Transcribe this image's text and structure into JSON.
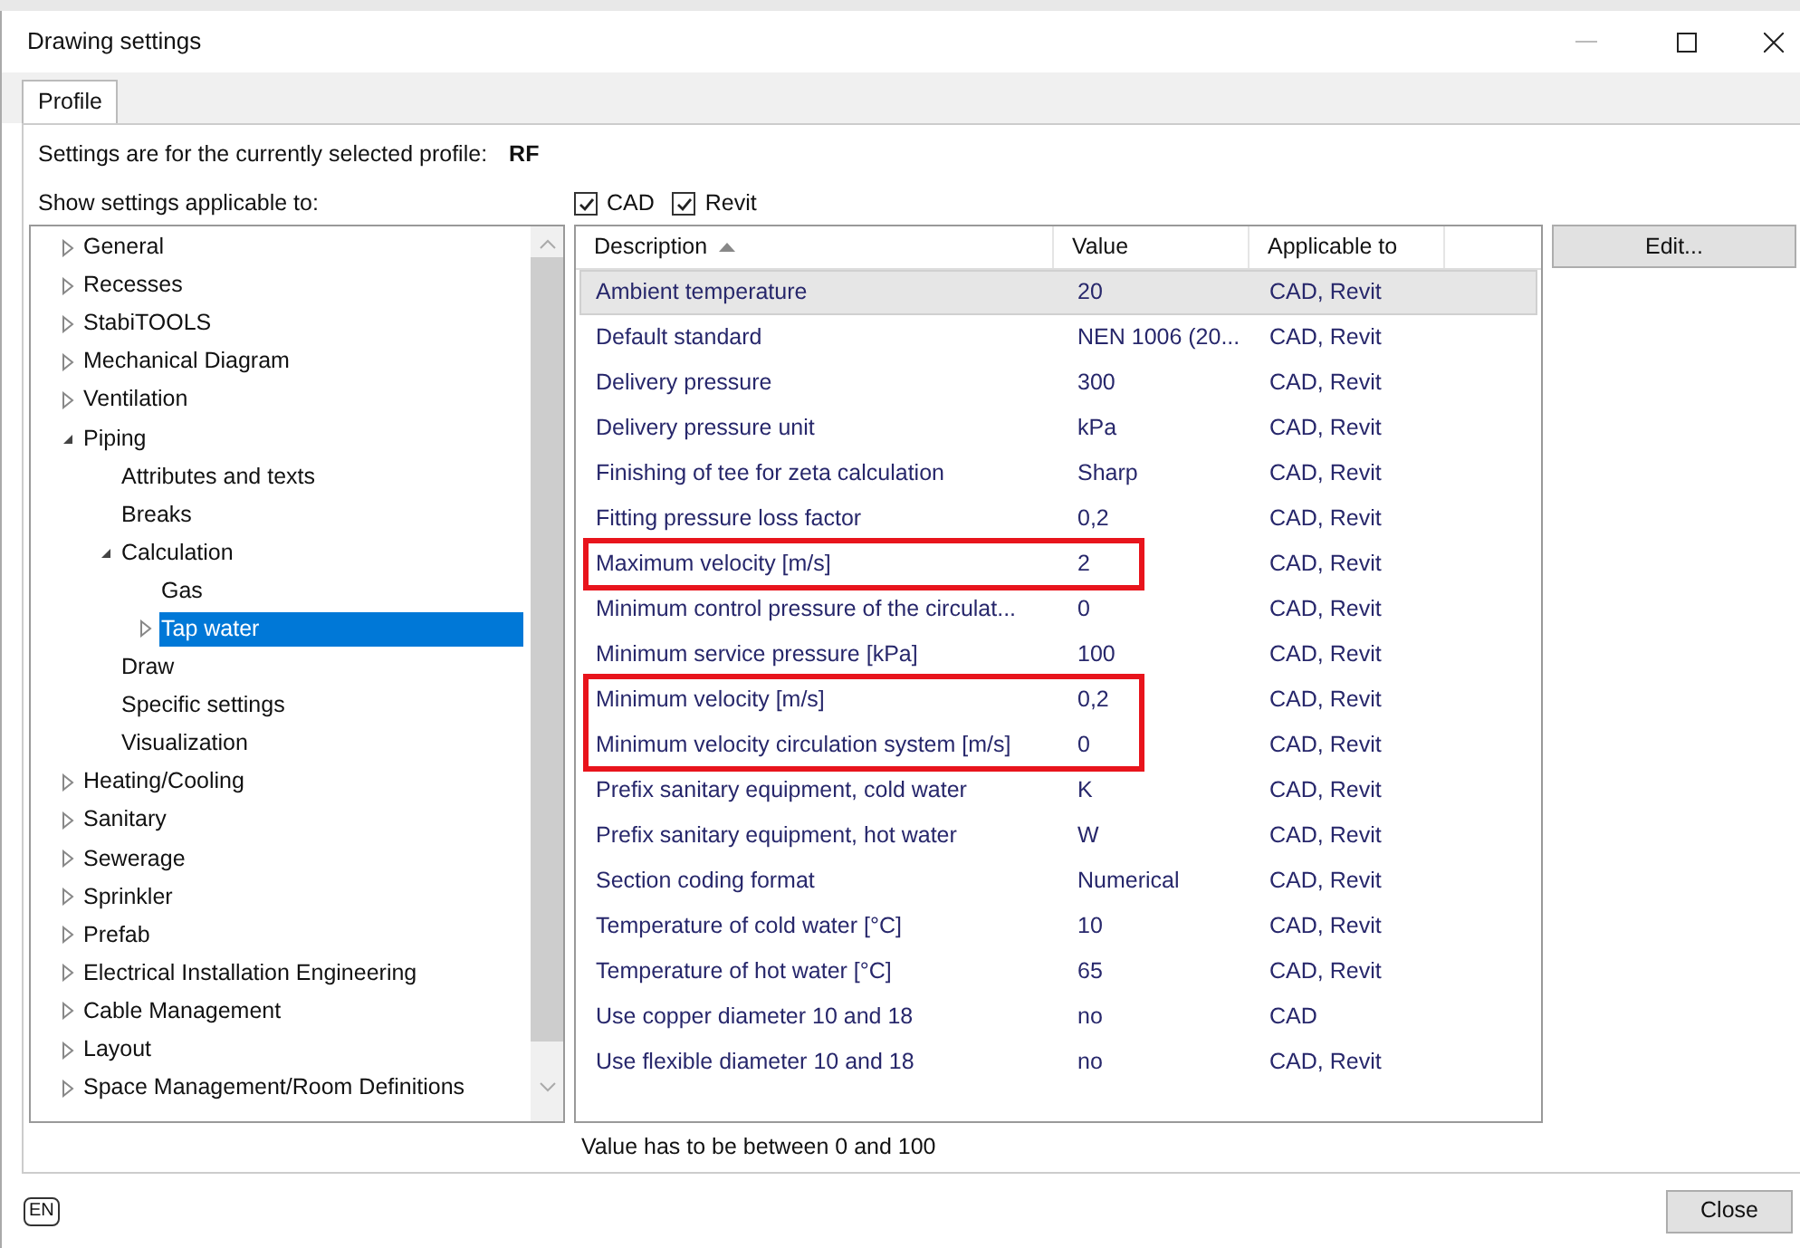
{
  "window": {
    "title": "Drawing settings"
  },
  "tabs": [
    {
      "label": "Profile",
      "selected": true
    }
  ],
  "profile_line": {
    "label": "Settings are for the currently selected profile:",
    "value": "RF"
  },
  "filter": {
    "label": "Show settings applicable to:",
    "options": [
      {
        "label": "CAD",
        "checked": true
      },
      {
        "label": "Revit",
        "checked": true
      }
    ]
  },
  "tree": [
    {
      "label": "General",
      "kind": "folder",
      "expanded": false,
      "selected": false
    },
    {
      "label": "Recesses",
      "kind": "folder",
      "expanded": false,
      "selected": false
    },
    {
      "label": "StabiTOOLS",
      "kind": "folder",
      "expanded": false,
      "selected": false
    },
    {
      "label": "Mechanical Diagram",
      "kind": "folder",
      "expanded": false,
      "selected": false
    },
    {
      "label": "Ventilation",
      "kind": "folder",
      "expanded": false,
      "selected": false
    },
    {
      "label": "Piping",
      "kind": "folder",
      "expanded": true,
      "selected": false,
      "children": [
        {
          "label": "Attributes and texts",
          "kind": "leaf",
          "selected": false
        },
        {
          "label": "Breaks",
          "kind": "leaf",
          "selected": false
        },
        {
          "label": "Calculation",
          "kind": "folder",
          "expanded": true,
          "selected": false,
          "children": [
            {
              "label": "Gas",
              "kind": "leaf",
              "selected": false
            },
            {
              "label": "Tap water",
              "kind": "folder",
              "expanded": false,
              "selected": true
            }
          ]
        },
        {
          "label": "Draw",
          "kind": "leaf",
          "selected": false
        },
        {
          "label": "Specific settings",
          "kind": "leaf",
          "selected": false
        },
        {
          "label": "Visualization",
          "kind": "leaf",
          "selected": false
        }
      ]
    },
    {
      "label": "Heating/Cooling",
      "kind": "folder",
      "expanded": false,
      "selected": false
    },
    {
      "label": "Sanitary",
      "kind": "folder",
      "expanded": false,
      "selected": false
    },
    {
      "label": "Sewerage",
      "kind": "folder",
      "expanded": false,
      "selected": false
    },
    {
      "label": "Sprinkler",
      "kind": "folder",
      "expanded": false,
      "selected": false
    },
    {
      "label": "Prefab",
      "kind": "folder",
      "expanded": false,
      "selected": false
    },
    {
      "label": "Electrical Installation Engineering",
      "kind": "folder",
      "expanded": false,
      "selected": false
    },
    {
      "label": "Cable Management",
      "kind": "folder",
      "expanded": false,
      "selected": false
    },
    {
      "label": "Layout",
      "kind": "folder",
      "expanded": false,
      "selected": false
    },
    {
      "label": "Space Management/Room Definitions",
      "kind": "folder",
      "expanded": false,
      "selected": false
    }
  ],
  "table": {
    "columns": [
      {
        "label": "Description",
        "sorted": true
      },
      {
        "label": "Value",
        "sorted": false
      },
      {
        "label": "Applicable to",
        "sorted": false
      }
    ],
    "rows": [
      {
        "description": "Ambient temperature",
        "value": "20",
        "applicable_to": "CAD, Revit",
        "selected": true,
        "highlighted": false
      },
      {
        "description": "Default standard",
        "value": "NEN 1006 (20...",
        "applicable_to": "CAD, Revit",
        "selected": false,
        "highlighted": false
      },
      {
        "description": "Delivery pressure",
        "value": "300",
        "applicable_to": "CAD, Revit",
        "selected": false,
        "highlighted": false
      },
      {
        "description": "Delivery pressure unit",
        "value": "kPa",
        "applicable_to": "CAD, Revit",
        "selected": false,
        "highlighted": false
      },
      {
        "description": "Finishing of tee for zeta calculation",
        "value": "Sharp",
        "applicable_to": "CAD, Revit",
        "selected": false,
        "highlighted": false
      },
      {
        "description": "Fitting pressure loss factor",
        "value": "0,2",
        "applicable_to": "CAD, Revit",
        "selected": false,
        "highlighted": false
      },
      {
        "description": "Maximum velocity [m/s]",
        "value": "2",
        "applicable_to": "CAD, Revit",
        "selected": false,
        "highlighted": true
      },
      {
        "description": "Minimum control pressure of the circulat...",
        "value": "0",
        "applicable_to": "CAD, Revit",
        "selected": false,
        "highlighted": false
      },
      {
        "description": "Minimum service pressure [kPa]",
        "value": "100",
        "applicable_to": "CAD, Revit",
        "selected": false,
        "highlighted": false
      },
      {
        "description": "Minimum velocity [m/s]",
        "value": "0,2",
        "applicable_to": "CAD, Revit",
        "selected": false,
        "highlighted": true
      },
      {
        "description": "Minimum velocity circulation system [m/s]",
        "value": "0",
        "applicable_to": "CAD, Revit",
        "selected": false,
        "highlighted": true
      },
      {
        "description": "Prefix sanitary equipment, cold water",
        "value": "K",
        "applicable_to": "CAD, Revit",
        "selected": false,
        "highlighted": false
      },
      {
        "description": "Prefix sanitary equipment, hot water",
        "value": "W",
        "applicable_to": "CAD, Revit",
        "selected": false,
        "highlighted": false
      },
      {
        "description": "Section coding format",
        "value": "Numerical",
        "applicable_to": "CAD, Revit",
        "selected": false,
        "highlighted": false
      },
      {
        "description": "Temperature of cold water [°C]",
        "value": "10",
        "applicable_to": "CAD, Revit",
        "selected": false,
        "highlighted": false
      },
      {
        "description": "Temperature of hot water [°C]",
        "value": "65",
        "applicable_to": "CAD, Revit",
        "selected": false,
        "highlighted": false
      },
      {
        "description": "Use copper diameter 10 and 18",
        "value": "no",
        "applicable_to": "CAD",
        "selected": false,
        "highlighted": false
      },
      {
        "description": "Use flexible diameter 10 and 18",
        "value": "no",
        "applicable_to": "CAD, Revit",
        "selected": false,
        "highlighted": false
      }
    ]
  },
  "edit_button": "Edit...",
  "message": "Value has to be between 0 and 100",
  "language": "EN",
  "close_button": "Close"
}
